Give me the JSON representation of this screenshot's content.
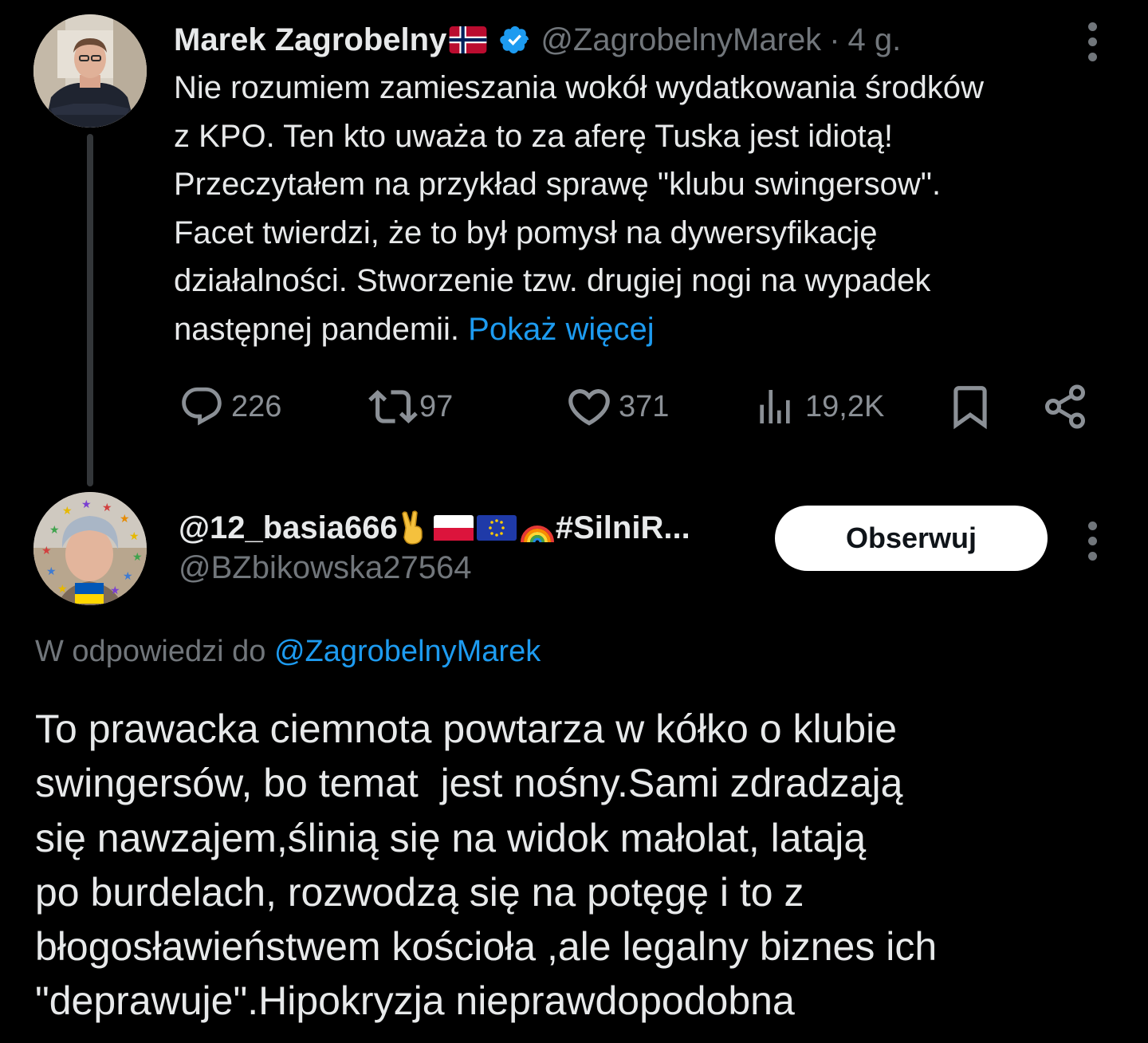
{
  "tweet": {
    "author_name": "Marek Zagrobelny",
    "author_handle": "@ZagrobelnyMarek",
    "separator": "·",
    "time": "4 g.",
    "body_lines": [
      "Nie rozumiem zamieszania wokół wydatkowania środków",
      "z KPO. Ten kto uważa to za aferę Tuska jest idiotą!",
      "Przeczytałem na przykład sprawę \"klubu swingersow\".",
      "Facet twierdzi, że to był pomysł na dywersyfikację",
      "działalności. Stworzenie tzw. drugiej nogi na wypadek",
      "następnej pandemii."
    ],
    "show_more": "Pokaż więcej",
    "stats": {
      "replies": "226",
      "reposts": "97",
      "likes": "371",
      "views": "19,2K"
    }
  },
  "reply": {
    "author_name": "@12_basia666",
    "author_name_tail": "#SilniR...",
    "author_handle": "@BZbikowska27564",
    "follow_label": "Obserwuj",
    "reply_to_prefix": "W odpowiedzi do",
    "reply_to_handle": "@ZagrobelnyMarek",
    "body_lines": [
      "To prawacka ciemnota powtarza w kółko o klubie",
      "swingersów, bo temat  jest nośny.Sami zdradzają",
      "się nawzajem,ślinią się na widok małolat, latają",
      "po burdelach, rozwodzą się na potęgę i to z",
      "błogosławieństwem kościoła ,ale legalny biznes ich",
      "\"deprawuje\".Hipokryzja nieprawdopodobna"
    ]
  },
  "colors": {
    "background": "#000000",
    "text_primary": "#e7e9ea",
    "text_secondary": "#71767b",
    "link": "#1d9bf0",
    "verified": "#1d9bf0",
    "follow_button_bg": "#ffffff"
  },
  "icons": [
    "norway-flag-icon",
    "verified-badge-icon",
    "more-icon",
    "reply-icon",
    "repost-icon",
    "like-icon",
    "views-icon",
    "bookmark-icon",
    "share-icon",
    "victory-hand-icon",
    "poland-flag-icon",
    "eu-flag-icon",
    "rainbow-icon"
  ]
}
